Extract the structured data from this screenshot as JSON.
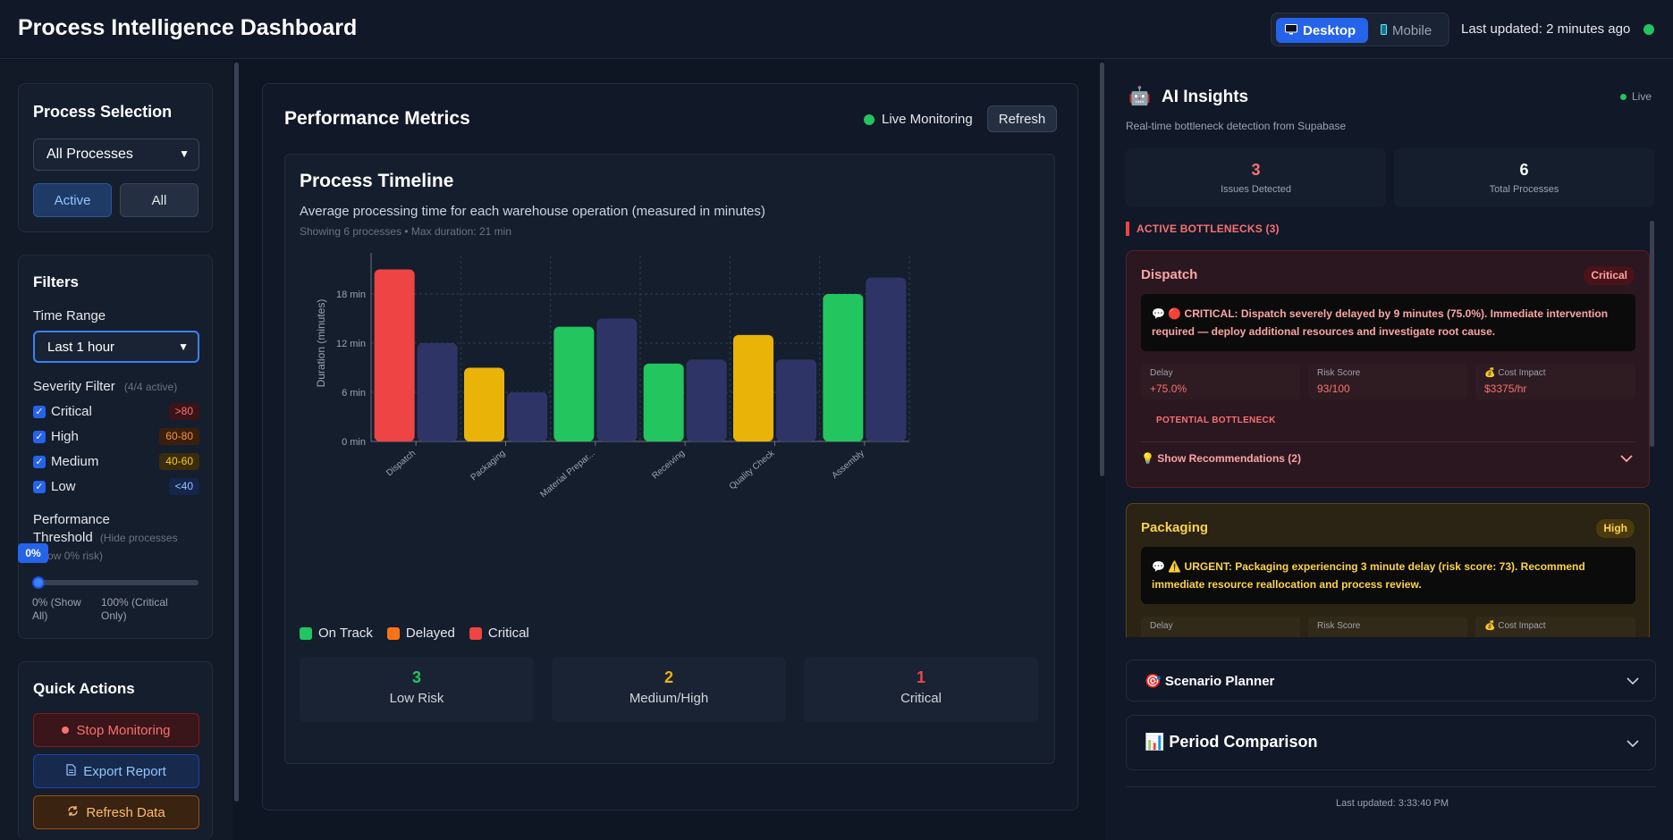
{
  "header": {
    "title": "Process Intelligence Dashboard",
    "view_desktop": "Desktop",
    "view_mobile": "Mobile",
    "last_updated": "Last updated: 2 minutes ago"
  },
  "sidebar": {
    "process_selection": {
      "title": "Process Selection",
      "selected": "All Processes",
      "active_label": "Active",
      "all_label": "All"
    },
    "filters": {
      "title": "Filters",
      "time_range_label": "Time Range",
      "time_range_value": "Last 1 hour",
      "severity_label": "Severity Filter",
      "severity_count": "(4/4 active)",
      "severity": [
        {
          "label": "Critical",
          "badge": ">80",
          "checked": true
        },
        {
          "label": "High",
          "badge": "60-80",
          "checked": true
        },
        {
          "label": "Medium",
          "badge": "40-60",
          "checked": true
        },
        {
          "label": "Low",
          "badge": "<40",
          "checked": true
        }
      ],
      "threshold_label_1": "Performance",
      "threshold_label_2": "Threshold",
      "threshold_hint_1": "(Hide processes",
      "threshold_hint_2": "below 0% risk)",
      "threshold_value": "0%",
      "threshold_level": 0,
      "min_label_1": "0% (Show",
      "min_label_2": "All)",
      "max_label_1": "100% (Critical",
      "max_label_2": "Only)"
    },
    "quick_actions": {
      "title": "Quick Actions",
      "stop": "Stop Monitoring",
      "export": "Export Report",
      "refresh": "Refresh Data"
    }
  },
  "main": {
    "title": "Performance Metrics",
    "live_label": "Live Monitoring",
    "refresh_label": "Refresh",
    "timeline": {
      "title": "Process Timeline",
      "description": "Average processing time for each warehouse operation (measured in minutes)",
      "subtitle": "Showing 6 processes • Max duration: 21 min"
    },
    "legend": [
      {
        "label": "On Track",
        "color": "#22c55e"
      },
      {
        "label": "Delayed",
        "color": "#f97316"
      },
      {
        "label": "Critical",
        "color": "#ef4444"
      }
    ],
    "summary": [
      {
        "value": "3",
        "label": "Low Risk",
        "color": "#22c55e"
      },
      {
        "value": "2",
        "label": "Medium/High",
        "color": "#eab308"
      },
      {
        "value": "1",
        "label": "Critical",
        "color": "#ef4444"
      }
    ]
  },
  "chart_data": {
    "type": "bar",
    "categories": [
      "Dispatch",
      "Packaging",
      "Material Prepar...",
      "Receiving",
      "Quality Check",
      "Assembly"
    ],
    "series": [
      {
        "values": [
          21,
          9,
          14,
          9.5,
          13,
          18
        ],
        "colors": [
          "#ef4444",
          "#eab308",
          "#22c55e",
          "#22c55e",
          "#eab308",
          "#22c55e"
        ]
      },
      {
        "values": [
          12,
          6,
          15,
          10,
          10,
          20
        ],
        "color": "#2e3566"
      }
    ],
    "ylabel": "Duration (minutes)",
    "ylim": [
      0,
      24
    ],
    "yticks": [
      "0 min",
      "6 min",
      "12 min",
      "18 min",
      "24 min"
    ],
    "grid": true
  },
  "ai": {
    "title": "AI Insights",
    "live": "Live",
    "subtitle": "Real-time bottleneck detection from Supabase",
    "issues_value": "3",
    "issues_label": "Issues Detected",
    "total_value": "6",
    "total_label": "Total Processes",
    "active_bottlenecks": "ACTIVE BOTTLENECKS (3)",
    "bottlenecks": [
      {
        "name": "Dispatch",
        "badge": "Critical",
        "message": "💬 🔴 CRITICAL: Dispatch severely delayed by 9 minutes (75.0%). Immediate intervention required — deploy additional resources and investigate root cause.",
        "delay_label": "Delay",
        "delay_value": "+75.0%",
        "risk_label": "Risk Score",
        "risk_value": "93/100",
        "cost_label": "💰 Cost Impact",
        "cost_value": "$3375/hr",
        "potential": "POTENTIAL BOTTLENECK",
        "recommendations": "💡 Show Recommendations (2)"
      },
      {
        "name": "Packaging",
        "badge": "High",
        "message": "💬 ⚠️ URGENT: Packaging experiencing 3 minute delay (risk score: 73). Recommend immediate resource reallocation and process review.",
        "delay_label": "Delay",
        "risk_label": "Risk Score",
        "cost_label": "💰 Cost Impact"
      }
    ],
    "scenario_planner": "🎯 Scenario Planner",
    "period_comparison": "📊 Period Comparison",
    "footer_updated": "Last updated: 3:33:40 PM"
  }
}
